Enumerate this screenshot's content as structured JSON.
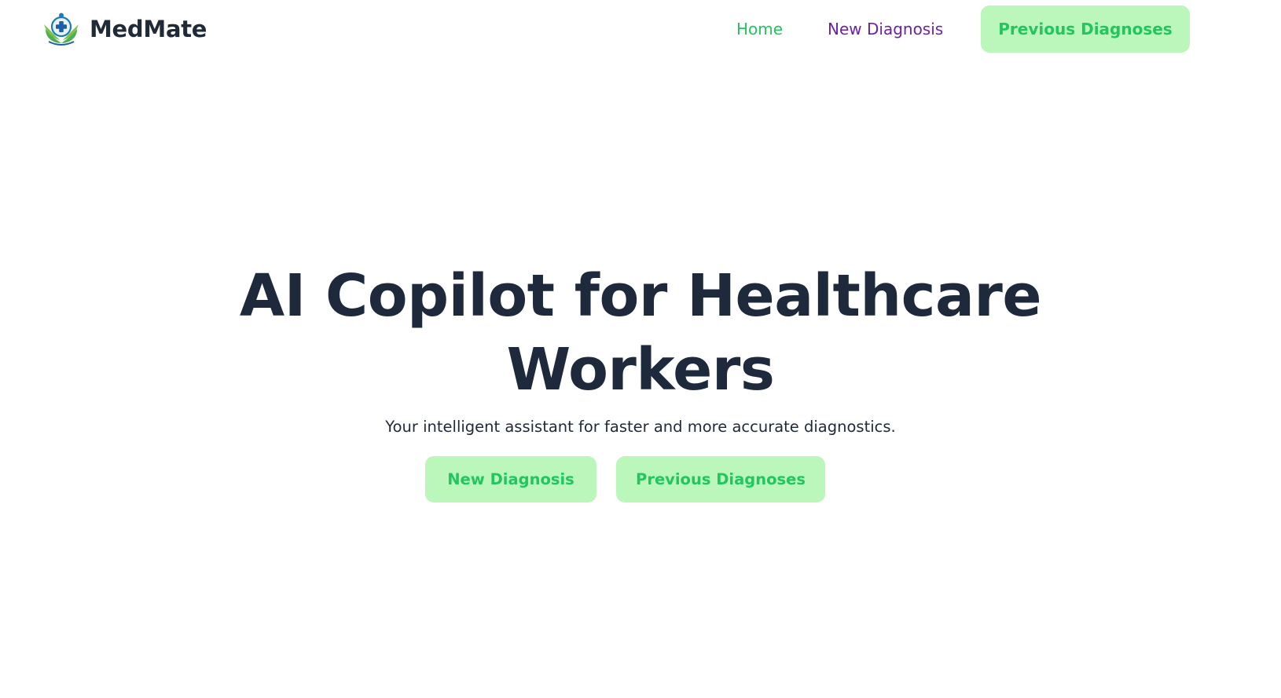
{
  "brand": {
    "name": "MedMate",
    "logo_icon": "medical-cross-leaves-logo-icon"
  },
  "nav": {
    "home_label": "Home",
    "new_diagnosis_label": "New Diagnosis",
    "previous_diagnoses_label": "Previous Diagnoses"
  },
  "hero": {
    "title": "AI Copilot for Healthcare Workers",
    "subtitle": "Your intelligent assistant for faster and more accurate diagnostics.",
    "new_diagnosis_label": "New Diagnosis",
    "previous_diagnoses_label": "Previous Diagnoses"
  },
  "colors": {
    "accent_green": "#22c55e",
    "button_bg": "#bbf7bb",
    "nav_purple": "#6b21a8",
    "heading_dark": "#1e293b"
  }
}
